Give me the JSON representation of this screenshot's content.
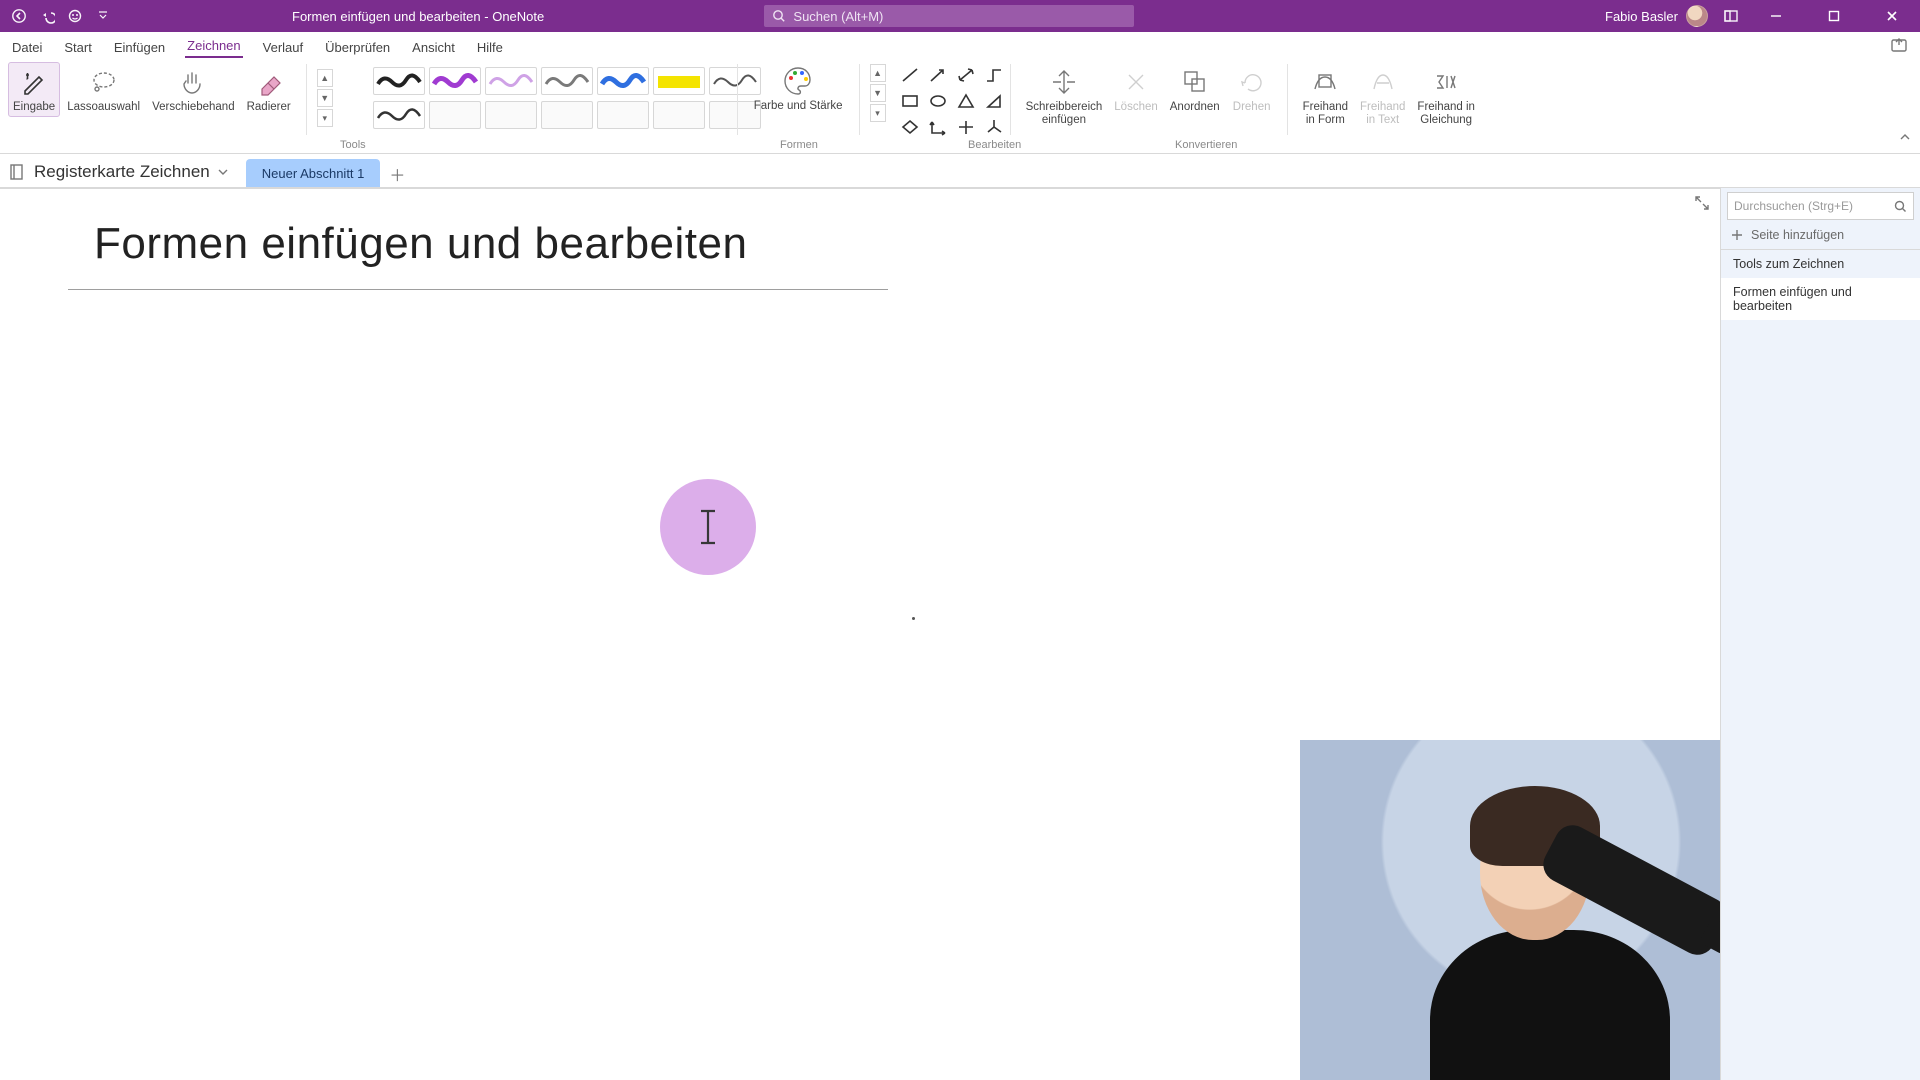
{
  "app_name": "OneNote",
  "title_doc": "Formen einfügen und bearbeiten",
  "title_sep": "  -  ",
  "search_placeholder": "Suchen (Alt+M)",
  "user_name": "Fabio Basler",
  "menu": {
    "datei": "Datei",
    "start": "Start",
    "einfuegen": "Einfügen",
    "zeichnen": "Zeichnen",
    "verlauf": "Verlauf",
    "ueberpruefen": "Überprüfen",
    "ansicht": "Ansicht",
    "hilfe": "Hilfe"
  },
  "ribbon": {
    "tools_label": "Tools",
    "formen_label": "Formen",
    "bearbeiten_label": "Bearbeiten",
    "konvertieren_label": "Konvertieren",
    "eingabe": "Eingabe",
    "lasso": "Lassoauswahl",
    "verschiebe": "Verschiebehand",
    "radierer": "Radierer",
    "farbe_staerke": "Farbe und\nStärke",
    "schreibbereich": "Schreibbereich\neinfügen",
    "loeschen": "Löschen",
    "anordnen": "Anordnen",
    "drehen": "Drehen",
    "freihand_form": "Freihand\nin Form",
    "freihand_text": "Freihand\nin Text",
    "freihand_gleichung": "Freihand in\nGleichung",
    "pen_colors": [
      "#222",
      "#a03bd1",
      "#cfa2e6",
      "#7a7a7a",
      "#2f6fe0",
      "#f4e400",
      "#555"
    ]
  },
  "notebook": {
    "name": "Registerkarte Zeichnen",
    "section_tab": "Neuer Abschnitt 1"
  },
  "page": {
    "title": "Formen einfügen und bearbeiten"
  },
  "right_panel": {
    "search_placeholder": "Durchsuchen (Strg+E)",
    "add_page": "Seite hinzufügen",
    "items": [
      "Tools zum Zeichnen",
      "Formen einfügen und bearbeiten"
    ],
    "selected_index": 1
  }
}
